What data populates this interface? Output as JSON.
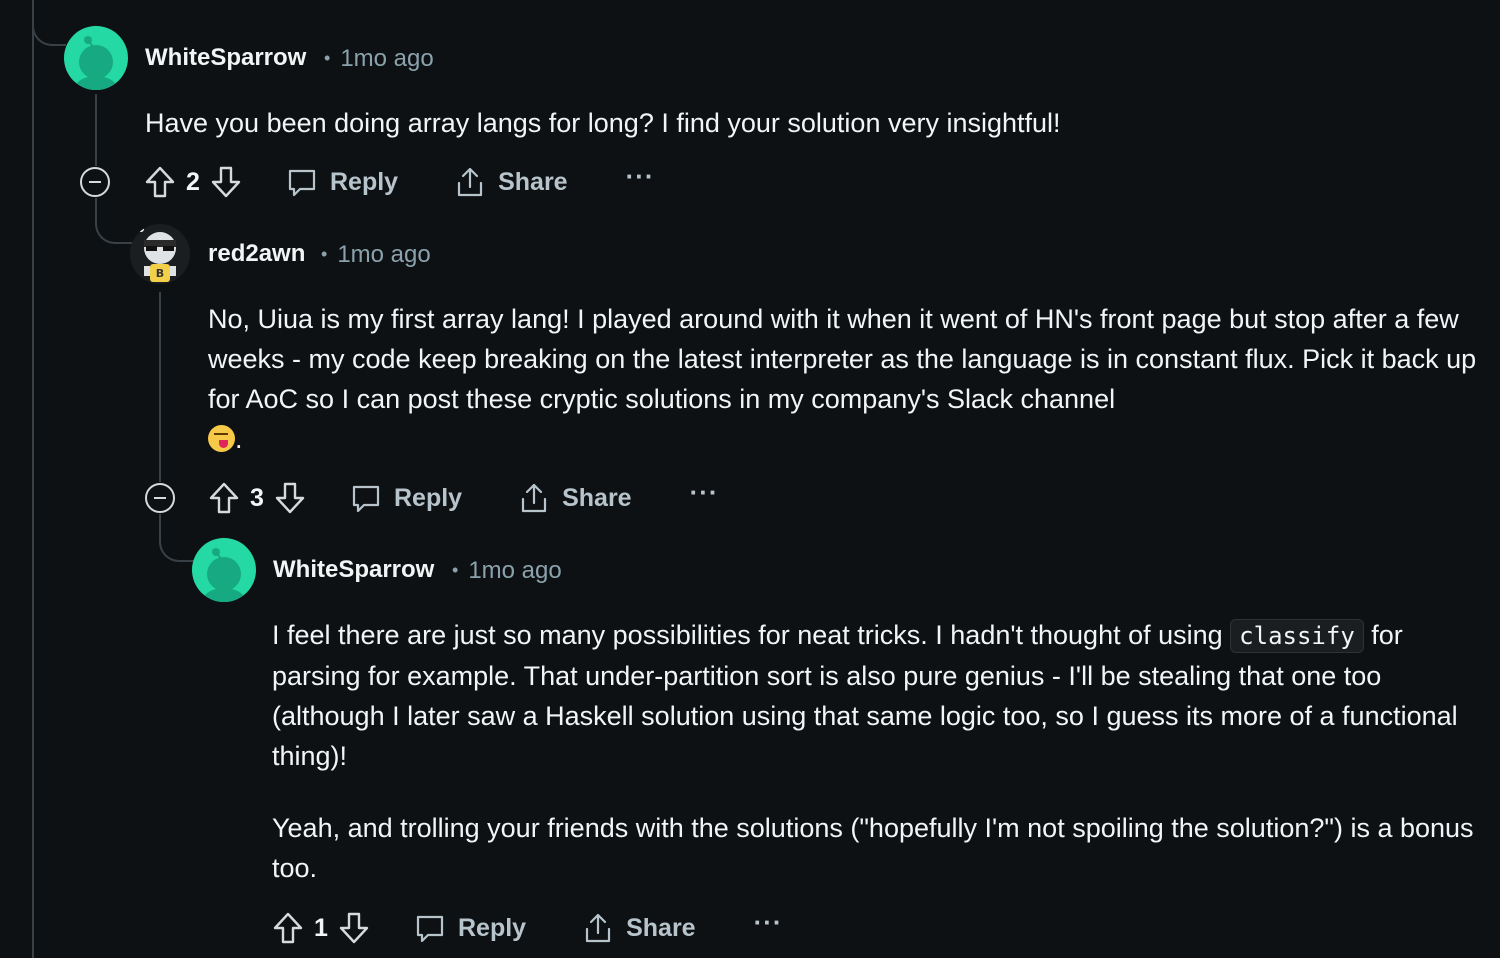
{
  "comments": [
    {
      "username": "WhiteSparrow",
      "time": "1mo ago",
      "separator": "•",
      "body": "Have you been doing array langs for long? I find your solution very insightful!",
      "votes": "2",
      "reply_label": "Reply",
      "share_label": "Share",
      "more_label": "···"
    },
    {
      "username": "red2awn",
      "time": "1mo ago",
      "separator": "•",
      "body": "No, Uiua is my first array lang! I played around with it when it went of HN's front page but stop after a few weeks - my code keep breaking on the latest interpreter as the language is in constant flux. Pick it back up for AoC so I can post these cryptic solutions in my company's Slack channel",
      "body_end": ".",
      "emoji": "squinting-face-with-tongue",
      "votes": "3",
      "reply_label": "Reply",
      "share_label": "Share",
      "more_label": "···"
    },
    {
      "username": "WhiteSparrow",
      "time": "1mo ago",
      "separator": "•",
      "para1_before": "I feel there are just so many possibilities for neat tricks. I hadn't thought of using ",
      "para1_code": "classify",
      "para1_after": " for parsing for example. That under-partition sort is also pure genius - I'll be stealing that one too (although I later saw a Haskell solution using that same logic too, so I guess its more of a functional thing)!",
      "para2": "Yeah, and trolling your friends with the solutions (\"hopefully I'm not spoiling the solution?\") is a bonus too.",
      "votes": "1",
      "reply_label": "Reply",
      "share_label": "Share",
      "more_label": "···"
    }
  ],
  "colors": {
    "background": "#0e1113",
    "thread_line": "#3a4146",
    "avatar_teal": "#24d9a4",
    "muted_text": "#8ba2ad",
    "action_text": "#b7c4cb"
  }
}
